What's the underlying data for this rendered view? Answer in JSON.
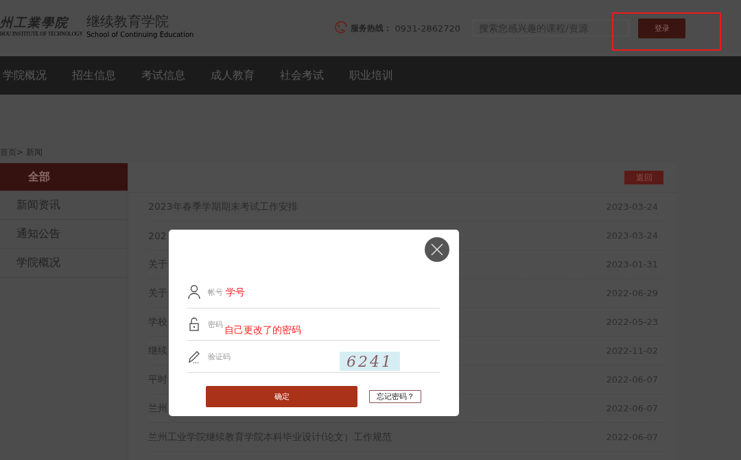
{
  "header": {
    "logo": {
      "calligraphy": "州工業學院",
      "english": "HOU INSTITUTE OF TECHNOLOGY"
    },
    "school": {
      "name": "继续教育学院",
      "english": "School of Continuing Education"
    },
    "hotline": {
      "label": "服务热线：",
      "number": "0931-2862720"
    },
    "search": {
      "placeholder": "搜索您感兴趣的课程/资源"
    },
    "login_button": {
      "label": "登录",
      "highlighted": true
    }
  },
  "nav": {
    "items": [
      "学院概况",
      "招生信息",
      "考试信息",
      "成人教育",
      "社会考试",
      "职业培训"
    ]
  },
  "breadcrumb": "首页> 新闻",
  "sidebar": {
    "items": [
      {
        "label": "全部",
        "selected": true
      },
      {
        "label": "新闻资讯",
        "selected": false
      },
      {
        "label": "通知公告",
        "selected": false
      },
      {
        "label": "学院概况",
        "selected": false
      }
    ]
  },
  "news": {
    "back_button": "返回",
    "rows": [
      {
        "title": "2023年春季学期期末考试工作安排",
        "date": "2023-03-24"
      },
      {
        "title": "202",
        "date": "2023-03-24"
      },
      {
        "title": "关于",
        "date": "2023-01-31"
      },
      {
        "title": "关于",
        "date": "2022-06-29"
      },
      {
        "title": "学校",
        "date": "2022-05-23"
      },
      {
        "title": "继续",
        "date": "2022-11-02"
      },
      {
        "title": "平时",
        "date": "2022-06-07"
      },
      {
        "title": "兰州",
        "date": "2022-06-07"
      },
      {
        "title": "兰州工业学院继续教育学院本科毕业设计(论文）工作规范",
        "date": "2022-06-07"
      }
    ]
  },
  "login_dialog": {
    "fields": [
      {
        "kind": "account",
        "placeholder": "帐号",
        "annotation": "学号"
      },
      {
        "kind": "password",
        "placeholder": "密码",
        "annotation": "自己更改了的密码"
      },
      {
        "kind": "captcha",
        "placeholder": "验证码",
        "captcha": "6241"
      }
    ],
    "confirm_button": "确定",
    "forgot_button": "忘记密码？"
  }
}
